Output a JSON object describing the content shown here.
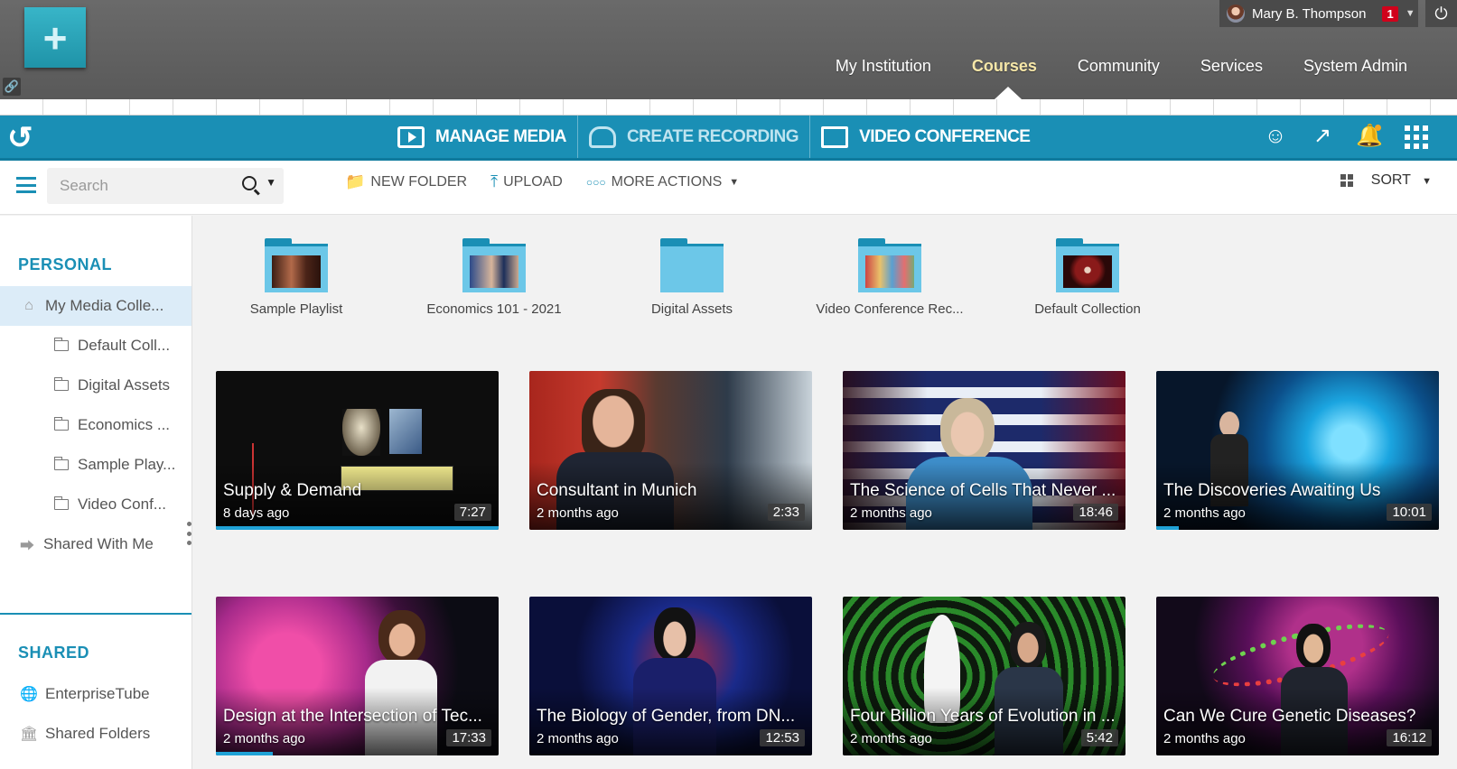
{
  "header": {
    "user_name": "Mary B. Thompson",
    "notification_count": "1",
    "nav": [
      "My Institution",
      "Courses",
      "Community",
      "Services",
      "System Admin"
    ],
    "active_nav": "Courses"
  },
  "media_bar": {
    "tabs": [
      "MANAGE MEDIA",
      "CREATE RECORDING",
      "VIDEO CONFERENCE"
    ]
  },
  "toolbar": {
    "search_placeholder": "Search",
    "new_folder": "NEW FOLDER",
    "upload": "UPLOAD",
    "more_actions": "MORE ACTIONS",
    "sort": "SORT"
  },
  "sidebar": {
    "personal_heading": "PERSONAL",
    "my_media": "My Media Colle...",
    "folders": [
      "Default Coll...",
      "Digital Assets",
      "Economics ...",
      "Sample Play...",
      "Video Conf..."
    ],
    "shared_with_me": "Shared With Me",
    "shared_heading": "SHARED",
    "enterprise": "EnterpriseTube",
    "shared_folders": "Shared Folders"
  },
  "folders": [
    {
      "label": "Sample Playlist"
    },
    {
      "label": "Economics 101 - 2021"
    },
    {
      "label": "Digital Assets"
    },
    {
      "label": "Video Conference Rec..."
    },
    {
      "label": "Default Collection"
    }
  ],
  "videos": [
    {
      "title": "Supply & Demand",
      "age": "8 days ago",
      "duration": "7:27",
      "progress": 1.0
    },
    {
      "title": "Consultant in Munich",
      "age": "2 months ago",
      "duration": "2:33",
      "progress": 0
    },
    {
      "title": "The Science of Cells That Never ...",
      "age": "2 months ago",
      "duration": "18:46",
      "progress": 0
    },
    {
      "title": "The Discoveries Awaiting Us",
      "age": "2 months ago",
      "duration": "10:01",
      "progress": 0.08
    },
    {
      "title": "Design at the Intersection of Tec...",
      "age": "2 months ago",
      "duration": "17:33",
      "progress": 0.2
    },
    {
      "title": "The Biology of Gender, from DN...",
      "age": "2 months ago",
      "duration": "12:53",
      "progress": 0
    },
    {
      "title": "Four Billion Years of Evolution in ...",
      "age": "2 months ago",
      "duration": "5:42",
      "progress": 0
    },
    {
      "title": "Can We Cure Genetic Diseases?",
      "age": "2 months ago",
      "duration": "16:12",
      "progress": 0
    }
  ],
  "colors": {
    "accent": "#1a8fb5",
    "active_nav": "#f6e7a8",
    "badge": "#d0021b"
  }
}
